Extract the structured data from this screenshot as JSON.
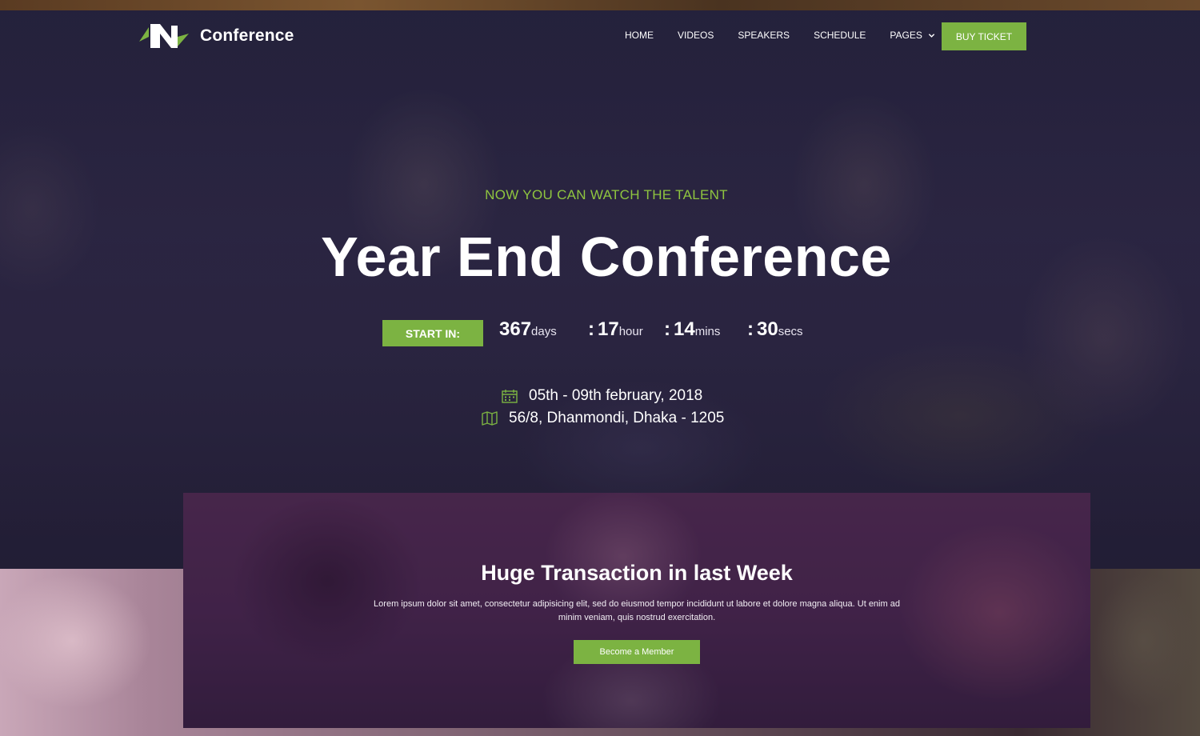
{
  "brand": {
    "name": "Conference",
    "logo_icon": "logo-mark-icon"
  },
  "nav": {
    "items": [
      {
        "label": "HOME"
      },
      {
        "label": "VIDEOS"
      },
      {
        "label": "SPEAKERS"
      },
      {
        "label": "SCHEDULE"
      },
      {
        "label": "PAGES",
        "icon": "chevron-down-icon"
      }
    ],
    "cta_label": "BUY TICKET"
  },
  "hero": {
    "tagline": "NOW YOU CAN WATCH THE TALENT",
    "title": "Year End Conference",
    "countdown": {
      "start_label": "START IN:",
      "days": {
        "value": "367",
        "unit": "days"
      },
      "hours": {
        "value": "17",
        "unit": "hour"
      },
      "mins": {
        "value": "14",
        "unit": "mins"
      },
      "secs": {
        "value": "30",
        "unit": "secs"
      },
      "separator": ":"
    },
    "date": {
      "icon": "calendar-icon",
      "text": "05th - 09th february, 2018"
    },
    "location": {
      "icon": "map-icon",
      "text": "56/8, Dhanmondi, Dhaka - 1205"
    }
  },
  "promo": {
    "title": "Huge Transaction in last Week",
    "text": "Lorem ipsum dolor sit amet, consectetur adipisicing elit, sed do eiusmod tempor incididunt ut labore et dolore magna aliqua. Ut enim ad minim veniam, quis nostrud exercitation.",
    "button_label": "Become a Member"
  },
  "colors": {
    "accent": "#7cb342",
    "tagline": "#8fc53f"
  }
}
